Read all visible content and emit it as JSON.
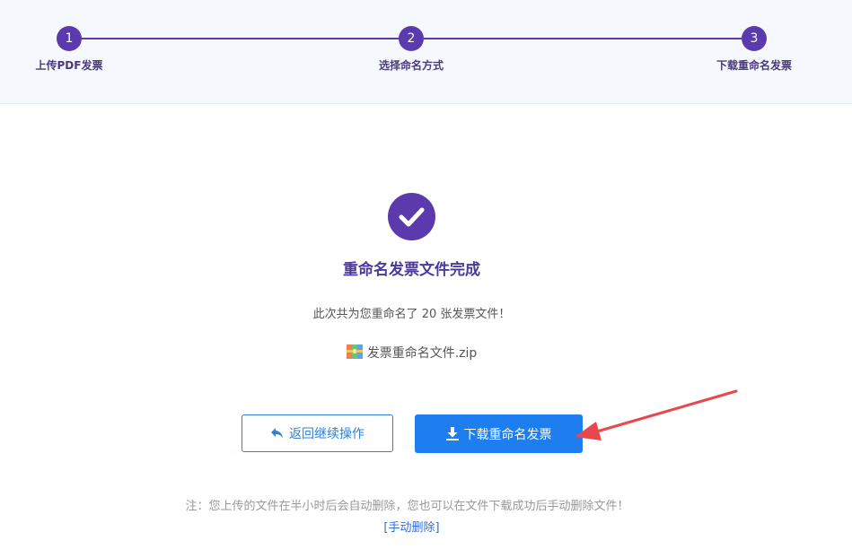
{
  "stepper": {
    "steps": [
      {
        "number": "1",
        "label": "上传PDF发票"
      },
      {
        "number": "2",
        "label": "选择命名方式"
      },
      {
        "number": "3",
        "label": "下载重命名发票"
      }
    ]
  },
  "result": {
    "icon": "check-icon",
    "title": "重命名发票文件完成",
    "summary": "此次共为您重命名了 20 张发票文件！",
    "file_icon": "zip-archive-icon",
    "file_name": "发票重命名文件.zip"
  },
  "actions": {
    "back_label": "返回继续操作",
    "back_icon": "reply-arrow-icon",
    "download_label": "下载重命名发票",
    "download_icon": "download-icon"
  },
  "note": {
    "text": "注：您上传的文件在半小时后会自动删除，您也可以在文件下载成功后手动删除文件！",
    "manual_delete_label": "[手动删除]"
  },
  "colors": {
    "accent_purple": "#5b3aad",
    "button_blue": "#1e7ef0",
    "annotation_red": "#e8474b"
  }
}
